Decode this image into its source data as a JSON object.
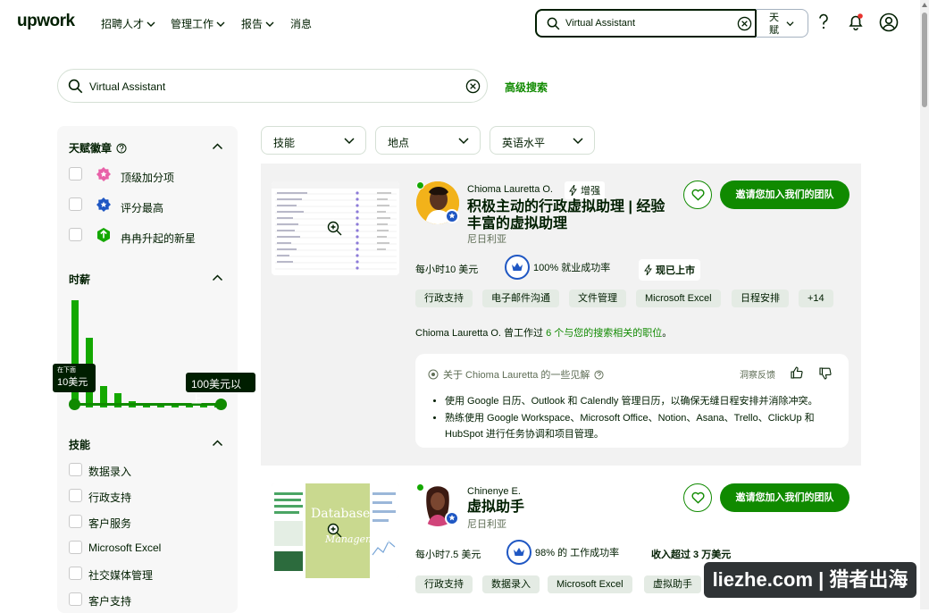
{
  "header": {
    "logo": "upwork",
    "nav": [
      "招聘人才",
      "管理工作",
      "报告",
      "消息"
    ],
    "search_value": "Virtual Assistant",
    "search_scope": "天赋"
  },
  "search": {
    "value": "Virtual Assistant",
    "advanced_label": "高级搜索"
  },
  "sidebar": {
    "badges_title": "天赋徽章",
    "badges": [
      "顶级加分项",
      "评分最高",
      "冉冉升起的新星"
    ],
    "rate_title": "时薪",
    "rate_min_top": "在下面",
    "rate_min": "10美元",
    "rate_max": "100美元以上",
    "rate_histogram": [
      1.0,
      0.65,
      0.2,
      0.13,
      0.06,
      0.04,
      0.04,
      0.03,
      0.03,
      0.03,
      0.02
    ],
    "skills_title": "技能",
    "skills": [
      "数据录入",
      "行政支持",
      "客户服务",
      "Microsoft Excel",
      "社交媒体管理",
      "客户支持"
    ]
  },
  "filters": [
    "技能",
    "地点",
    "英语水平"
  ],
  "freelancers": [
    {
      "name": "Chioma Lauretta O.",
      "boost": "增强",
      "title_line1": "积极主动的行政虚拟助理 | 经验",
      "title_line2": "丰富的虚拟助理",
      "location": "尼日利亚",
      "invite": "邀请您加入我们的团队",
      "rate": "每小时10 美元",
      "jss": "100% 就业成功率",
      "availability": "现已上市",
      "skills": [
        "行政支持",
        "电子邮件沟通",
        "文件管理",
        "Microsoft Excel",
        "日程安排",
        "+14"
      ],
      "worked_prefix": "Chioma Lauretta O. 曾工作过 ",
      "worked_link": "6 个与您的搜索相关的职位",
      "worked_suffix": "。",
      "insight_title": "关于 Chioma Lauretta 的一些见解",
      "insight_feedback": "洞察反馈",
      "insights": [
        "使用 Google 日历、Outlook 和 Calendly 管理日历，以确保无缝日程安排并消除冲突。",
        "熟练使用 Google Workspace、Microsoft Office、Notion、Asana、Trello、ClickUp 和 HubSpot 进行任务协调和项目管理。"
      ]
    },
    {
      "name": "Chinenye E.",
      "title_line1": "虚拟助手",
      "location": "尼日利亚",
      "invite": "邀请您加入我们的团队",
      "rate": "每小时7.5 美元",
      "jss": "98% 的 工作成功率",
      "earned": "收入超过 3 万美元",
      "thumb_text1": "Database",
      "thumb_text2": "Management",
      "skills": [
        "行政支持",
        "数据录入",
        "Microsoft Excel",
        "虚拟助手"
      ]
    }
  ],
  "watermark": "liezhe.com | 猎者出海"
}
